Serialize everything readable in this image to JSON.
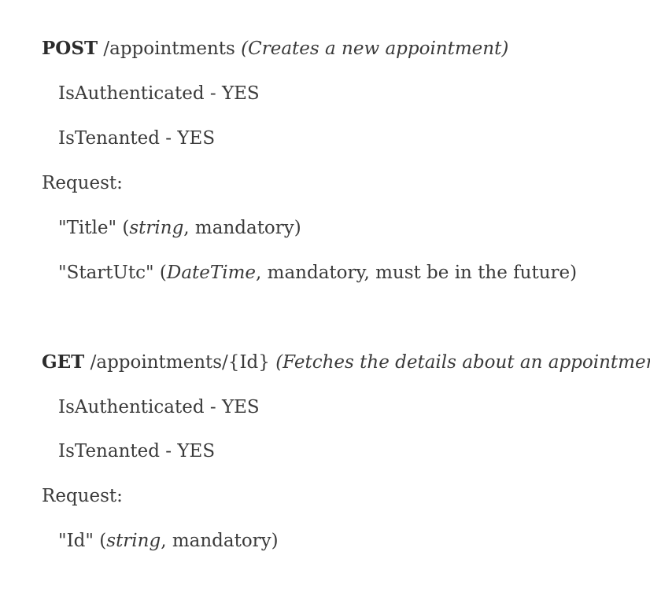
{
  "endpoints": [
    {
      "method": "POST",
      "path": "/appointments",
      "description": "(Creates a new appointment)",
      "is_authenticated": "IsAuthenticated - YES",
      "is_tenanted": "IsTenanted - YES",
      "request_label": "Request:",
      "params": [
        {
          "open": "\"Title\" (",
          "type": "string",
          "rest": ", mandatory)"
        },
        {
          "open": "\"StartUtc\" (",
          "type": "DateTime",
          "rest": ", mandatory, must be in the future)"
        }
      ]
    },
    {
      "method": "GET",
      "path": "/appointments/{Id}",
      "description": "(Fetches the details about an appointment)",
      "is_authenticated": "IsAuthenticated - YES",
      "is_tenanted": "IsTenanted - YES",
      "request_label": "Request:",
      "params": [
        {
          "open": "\"Id\" (",
          "type": "string",
          "rest": ", mandatory)"
        }
      ]
    }
  ]
}
